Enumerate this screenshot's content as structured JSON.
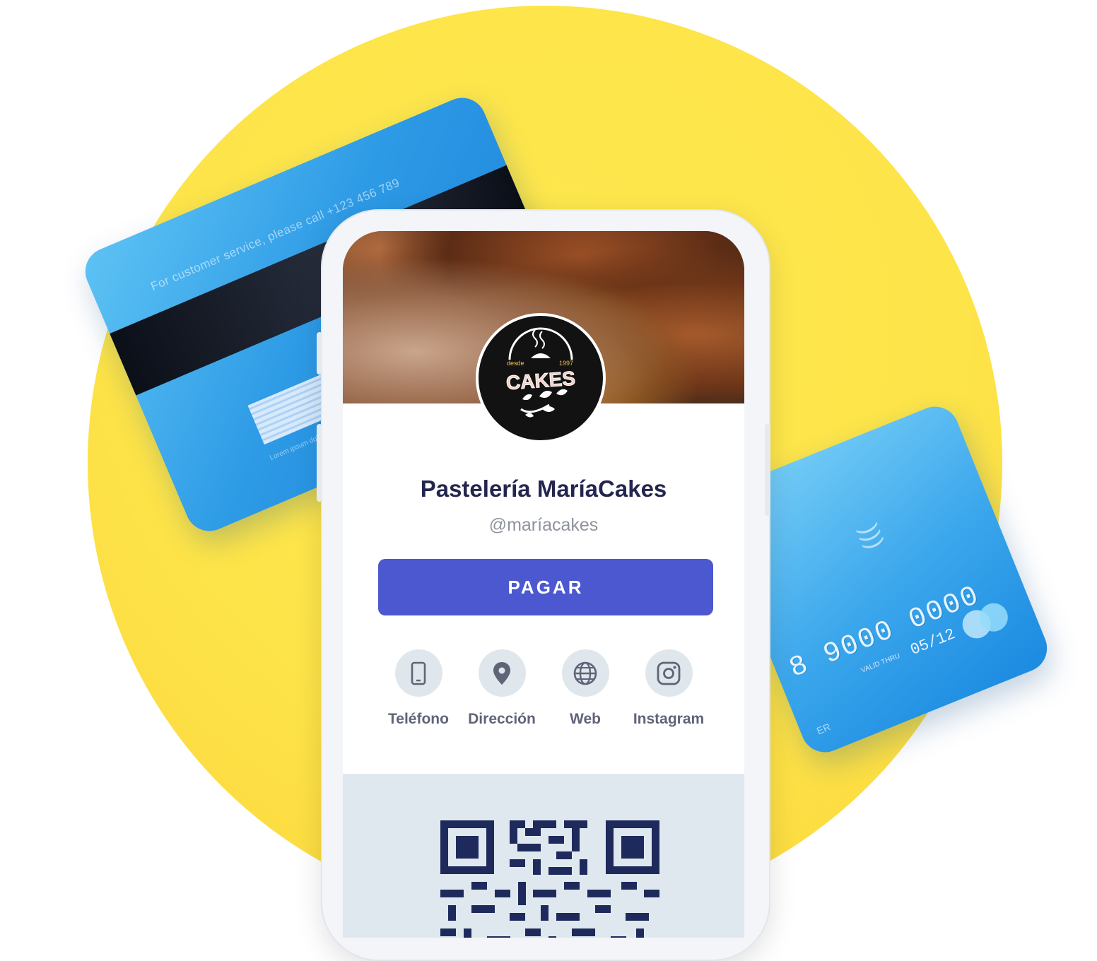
{
  "card_back": {
    "service_text": "For customer service, please call +123 456 789",
    "fine_print": "Lorem ipsum dolor sit amet, viverra. Aenean ultrices vulputate est metus rhoncus eget sit amet"
  },
  "card_front": {
    "number": "8 9000 0000",
    "valid_thru_label": "VALID THRU",
    "valid_thru": "05/12",
    "holder_fragment": "ER"
  },
  "logo": {
    "top_left": "desde",
    "top_right": "1997",
    "wordmark": "CAKES"
  },
  "profile": {
    "name": "Pastelería MaríaCakes",
    "handle": "@maríacakes",
    "pay_label": "PAGAR"
  },
  "actions": [
    {
      "label": "Teléfono",
      "icon": "phone-icon"
    },
    {
      "label": "Dirección",
      "icon": "location-pin-icon"
    },
    {
      "label": "Web",
      "icon": "globe-icon"
    },
    {
      "label": "Instagram",
      "icon": "instagram-icon"
    }
  ],
  "colors": {
    "background_circle": "#fde449",
    "card_blue": "#2e9be6",
    "pay_button": "#4b58cf",
    "title_text": "#24264f",
    "icon_bg": "#dfe7ec",
    "qr_dark": "#1f2a5c"
  }
}
